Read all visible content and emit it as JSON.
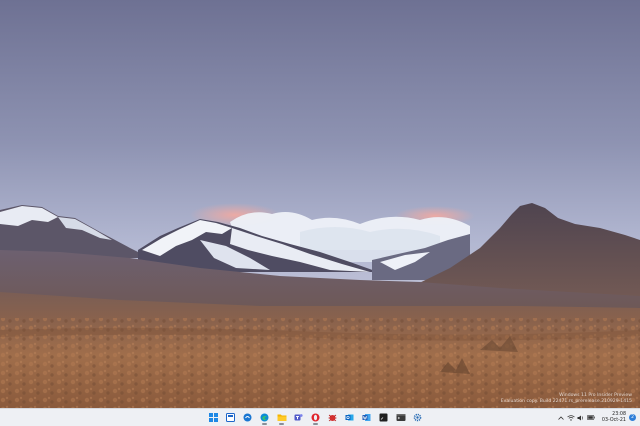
{
  "desktop": {
    "watermark": {
      "line1": "Windows 11 Pro Insider Preview",
      "line2": "Evaluation copy. Build 22471.rs_prerelease.210929-1415"
    }
  },
  "taskbar": {
    "pinned": [
      {
        "name": "start-button",
        "icon": "windows-logo-icon",
        "color": "#1e88e5",
        "running": false
      },
      {
        "name": "search-button",
        "icon": "search-icon",
        "color": "#2b2b2b",
        "running": false
      },
      {
        "name": "widgets-button",
        "icon": "widgets-icon",
        "color": "#1976d2",
        "running": false
      },
      {
        "name": "chat-button",
        "icon": "chat-icon",
        "color": "#5b5fc7",
        "running": false
      },
      {
        "name": "edge-button",
        "icon": "edge-icon",
        "color": "#0c8bd6",
        "running": true
      },
      {
        "name": "file-explorer-button",
        "icon": "folder-icon",
        "color": "#f4b400",
        "running": true
      },
      {
        "name": "teams-button",
        "icon": "teams-icon",
        "color": "#5059c9",
        "running": false
      },
      {
        "name": "opera-button",
        "icon": "opera-icon",
        "color": "#e0242b",
        "running": true
      },
      {
        "name": "app-red-button",
        "icon": "bug-icon",
        "color": "#d32f2f",
        "running": false
      },
      {
        "name": "outlook-button",
        "icon": "outlook-icon",
        "color": "#0a64c2",
        "running": false
      },
      {
        "name": "word-button",
        "icon": "word-icon",
        "color": "#1e5db8",
        "running": false
      },
      {
        "name": "terminal-dark-button",
        "icon": "terminal-icon",
        "color": "#1f1f1f",
        "running": false
      },
      {
        "name": "terminal-button",
        "icon": "console-icon",
        "color": "#3a3a3a",
        "running": false
      },
      {
        "name": "settings-button",
        "icon": "gear-icon",
        "color": "#2a6db5",
        "running": false
      }
    ],
    "tray": {
      "clock_time": "23:08",
      "clock_date": "03-Oct-21",
      "notification_count": "2"
    }
  }
}
